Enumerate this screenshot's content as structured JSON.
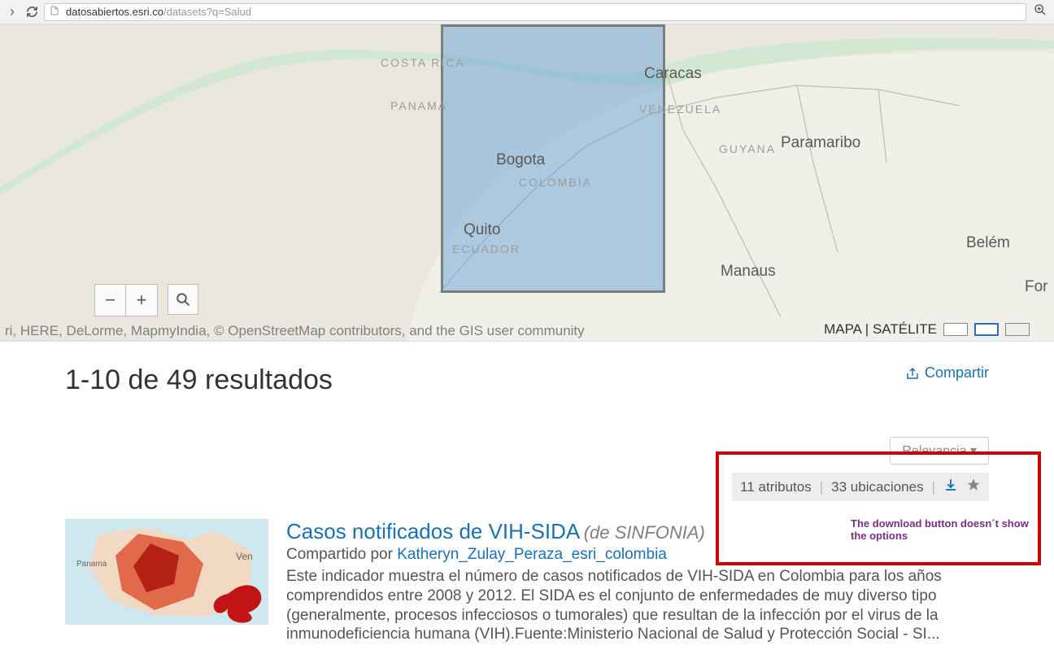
{
  "browser": {
    "url_host": "datosabiertos.esri.co",
    "url_path": "/datasets?q=Salud"
  },
  "map": {
    "labels": {
      "costa_rica": "COSTA RICA",
      "panama": "PANAMÁ",
      "caracas": "Caracas",
      "venezuela": "VENEZUELA",
      "bogota": "Bogota",
      "colombia": "COLOMBIA",
      "guyana": "GUYANA",
      "paramaribo": "Paramaribo",
      "quito": "Quito",
      "ecuador": "ECUADOR",
      "manaus": "Manaus",
      "belem": "Belém",
      "for": "For"
    },
    "attribution": "ri, HERE, DeLorme, MapmyIndia, © OpenStreetMap contributors, and the GIS user community",
    "toggle_label": "MAPA | SATÉLITE",
    "zoom_out": "−",
    "zoom_in": "+"
  },
  "results": {
    "count_text": "1-10 de 49 resultados",
    "share_label": "Compartir",
    "sort_label": "Relevancia ▾",
    "meta": {
      "attributes": "11 atributos",
      "locations": "33 ubicaciones"
    },
    "item": {
      "title": "Casos notificados de VIH-SIDA",
      "source": "(de SINFONIA)",
      "shared_prefix": "Compartido por ",
      "shared_user": "Katheryn_Zulay_Peraza_esri_colombia",
      "description": "Este indicador muestra el número de casos notificados de VIH-SIDA en Colombia para los años comprendidos entre 2008 y 2012. El SIDA es el conjunto de enfermedades de muy diverso tipo (generalmente, procesos infecciosos o tumorales) que resultan de la infección por el virus de la inmunodeficiencia humana (VIH).Fuente:Ministerio Nacional de Salud y Protección Social - SI..."
    }
  },
  "annotation": {
    "text": "The download button doesn´t show the options"
  }
}
